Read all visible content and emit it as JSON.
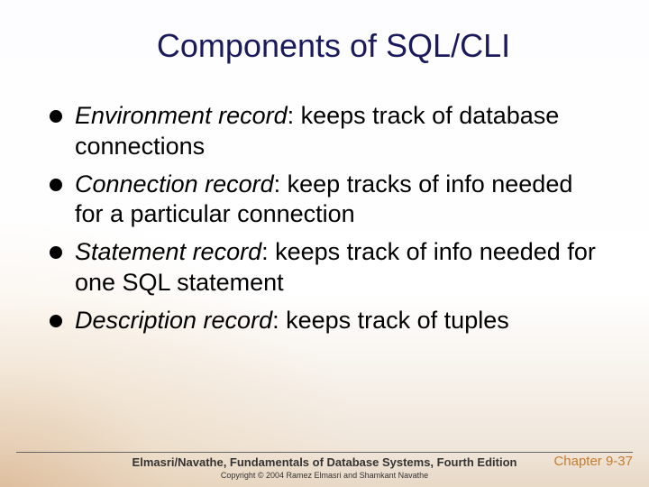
{
  "title": "Components of SQL/CLI",
  "bullets": [
    {
      "term": "Environment record",
      "rest": ": keeps track of database connections"
    },
    {
      "term": "Connection record",
      "rest": ": keep tracks of info needed for a particular connection"
    },
    {
      "term": "Statement record",
      "rest": ": keeps track of info needed for one SQL statement"
    },
    {
      "term": "Description record",
      "rest": ": keeps track of tuples"
    }
  ],
  "footer": {
    "book": "Elmasri/Navathe, Fundamentals of Database Systems, Fourth Edition",
    "chapter": "Chapter 9-37",
    "copyright": "Copyright © 2004 Ramez Elmasri and Shamkant Navathe"
  }
}
